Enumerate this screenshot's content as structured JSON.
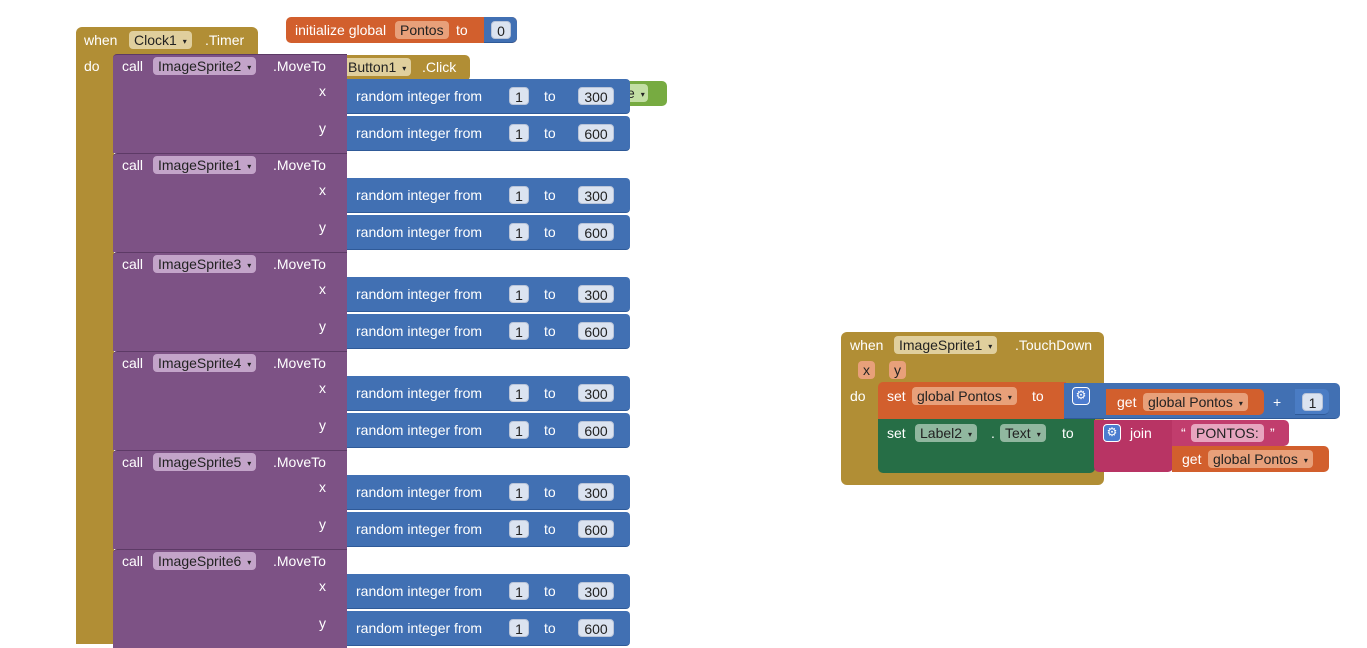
{
  "clock_timer": {
    "when": "when",
    "component": "Clock1",
    "event": ".Timer",
    "do": "do"
  },
  "init_global": {
    "label": "initialize global",
    "name": "Pontos",
    "to": "to",
    "value": "0"
  },
  "button_click": {
    "component": "Button1",
    "event": ".Click",
    "partial_text": "e"
  },
  "move_calls": [
    {
      "call": "call",
      "sprite": "ImageSprite2",
      "method": ".MoveTo",
      "x_label": "x",
      "y_label": "y",
      "x_from": "1",
      "x_to": "300",
      "y_from": "1",
      "y_to": "600"
    },
    {
      "call": "call",
      "sprite": "ImageSprite1",
      "method": ".MoveTo",
      "x_label": "x",
      "y_label": "y",
      "x_from": "1",
      "x_to": "300",
      "y_from": "1",
      "y_to": "600"
    },
    {
      "call": "call",
      "sprite": "ImageSprite3",
      "method": ".MoveTo",
      "x_label": "x",
      "y_label": "y",
      "x_from": "1",
      "x_to": "300",
      "y_from": "1",
      "y_to": "600"
    },
    {
      "call": "call",
      "sprite": "ImageSprite4",
      "method": ".MoveTo",
      "x_label": "x",
      "y_label": "y",
      "x_from": "1",
      "x_to": "300",
      "y_from": "1",
      "y_to": "600"
    },
    {
      "call": "call",
      "sprite": "ImageSprite5",
      "method": ".MoveTo",
      "x_label": "x",
      "y_label": "y",
      "x_from": "1",
      "x_to": "300",
      "y_from": "1",
      "y_to": "600"
    },
    {
      "call": "call",
      "sprite": "ImageSprite6",
      "method": ".MoveTo",
      "x_label": "x",
      "y_label": "y",
      "x_from": "1",
      "x_to": "300",
      "y_from": "1",
      "y_to": "600"
    }
  ],
  "random_label": "random integer from",
  "to_label": "to",
  "touchdown": {
    "when": "when",
    "component": "ImageSprite1",
    "event": ".TouchDown",
    "param_x": "x",
    "param_y": "y",
    "do": "do",
    "set1_label": "set",
    "set1_var": "global Pontos",
    "set1_to": "to",
    "get1_label": "get",
    "get1_var": "global Pontos",
    "plus": "+",
    "plus_value": "1",
    "set2_label": "set",
    "set2_component": "Label2",
    "set2_dot": ".",
    "set2_prop": "Text",
    "set2_to": "to",
    "join_label": "join",
    "string_open": "“",
    "string_value": "PONTOS: ",
    "string_close": "”",
    "get2_label": "get",
    "get2_var": "global Pontos"
  },
  "colors": {
    "event": "#b18e35",
    "procedure": "#7d5285",
    "math": "#4170b3",
    "variable": "#d25f2d",
    "component_setter": "#266e46",
    "text": "#b83464",
    "logic": "#77ab41"
  },
  "icons": {
    "dropdown": "▾",
    "mutator": "⚙"
  }
}
